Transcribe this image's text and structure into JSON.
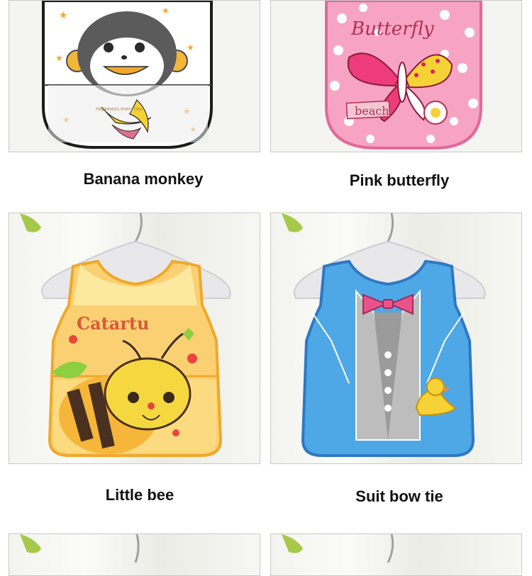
{
  "products": [
    {
      "name": "Banana monkey",
      "bib_text": "Happiness every day"
    },
    {
      "name": "Pink butterfly",
      "bib_text": "Butterfly",
      "tag_text": "beach"
    },
    {
      "name": "Little bee",
      "bib_text": "Catartu"
    },
    {
      "name": "Suit bow tie"
    }
  ],
  "colors": {
    "monkey_bib": "#ffffff",
    "butterfly_bib": "#f7a3c4",
    "bee_bib": "#fad072",
    "suit_bib": "#4ea8e6"
  }
}
